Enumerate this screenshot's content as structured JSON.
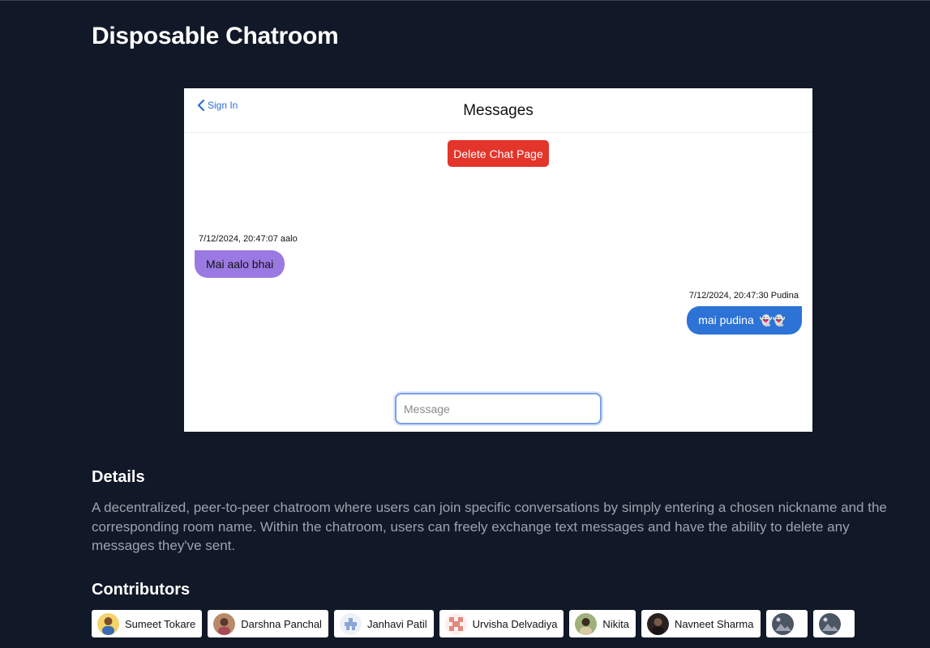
{
  "page": {
    "title": "Disposable Chatroom"
  },
  "screenshot": {
    "back_label": "Sign In",
    "header_title": "Messages",
    "delete_button": "Delete Chat Page",
    "messages": [
      {
        "meta": "7/12/2024, 20:47:07 aalo",
        "text": "Mai aalo bhai",
        "side": "left"
      },
      {
        "meta": "7/12/2024, 20:47:30 Pudina",
        "text": "mai pudina",
        "emoji": "👻👻",
        "side": "right"
      }
    ],
    "input_placeholder": "Message"
  },
  "details": {
    "heading": "Details",
    "text": "A decentralized, peer-to-peer chatroom where users can join specific conversations by simply entering a chosen nickname and the corresponding room name. Within the chatroom, users can freely exchange text messages and have the ability to delete any messages they've sent."
  },
  "contributors": {
    "heading": "Contributors",
    "list": [
      {
        "name": "Sumeet Tokare",
        "avatar": "photo"
      },
      {
        "name": "Darshna Panchal",
        "avatar": "photo"
      },
      {
        "name": "Janhavi Patil",
        "avatar": "identicon-blue"
      },
      {
        "name": "Urvisha Delvadiya",
        "avatar": "identicon-red"
      },
      {
        "name": "Nikita",
        "avatar": "photo"
      },
      {
        "name": "Navneet Sharma",
        "avatar": "photo"
      },
      {
        "name": "",
        "avatar": "broken-image"
      },
      {
        "name": "",
        "avatar": "broken-image"
      }
    ]
  },
  "colors": {
    "background": "#111827",
    "delete_button": "#e4352b",
    "bubble_left": "#9b79e2",
    "bubble_right": "#2d73d6",
    "link": "#2f6fd6"
  }
}
